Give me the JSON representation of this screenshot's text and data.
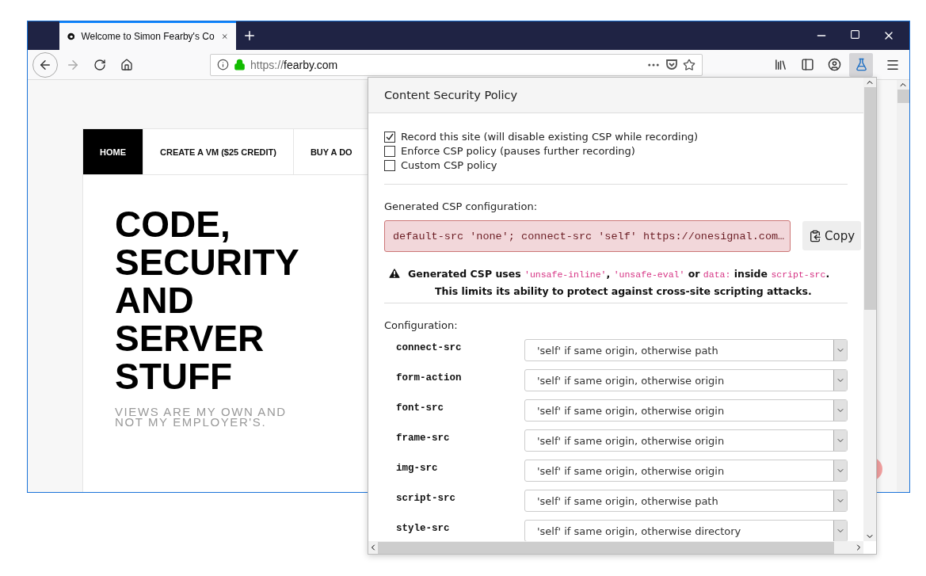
{
  "tab": {
    "title": "Welcome to Simon Fearby's Co"
  },
  "address_bar": {
    "scheme": "https://",
    "host": "fearby.com"
  },
  "toolbar": {
    "extension_active": true
  },
  "site_nav": [
    {
      "label": "HOME",
      "selected": true
    },
    {
      "label": "CREATE A VM ($25 CREDIT)",
      "selected": false
    },
    {
      "label": "BUY A DO",
      "selected": false
    }
  ],
  "site_title": "CODE, SECURITY AND SERVER STUFF",
  "site_tagline": "VIEWS ARE MY OWN AND NOT MY EMPLOYER'S.",
  "popup": {
    "title": "Content Security Policy",
    "options": [
      {
        "label": "Record this site (will disable existing CSP while recording)",
        "checked": true
      },
      {
        "label": "Enforce CSP policy (pauses further recording)",
        "checked": false
      },
      {
        "label": "Custom CSP policy",
        "checked": false
      }
    ],
    "generated_label": "Generated CSP configuration:",
    "generated_value": "default-src 'none'; connect-src 'self' https://onesignal.com…",
    "copy_button": "Copy",
    "warning": [
      {
        "kind": "text",
        "text": "Generated CSP uses "
      },
      {
        "kind": "code",
        "text": "'unsafe-inline'"
      },
      {
        "kind": "text",
        "text": ", "
      },
      {
        "kind": "code",
        "text": "'unsafe-eval'"
      },
      {
        "kind": "text",
        "text": " or "
      },
      {
        "kind": "code",
        "text": "data:"
      },
      {
        "kind": "text",
        "text": " inside "
      },
      {
        "kind": "code",
        "text": "script-src"
      },
      {
        "kind": "text",
        "text": "."
      }
    ],
    "warning_line_2": "This limits its ability to protect against cross-site scripting attacks.",
    "configuration_label": "Configuration:",
    "directives": [
      {
        "name": "connect-src",
        "value": "'self' if same origin, otherwise path"
      },
      {
        "name": "form-action",
        "value": "'self' if same origin, otherwise origin"
      },
      {
        "name": "font-src",
        "value": "'self' if same origin, otherwise origin"
      },
      {
        "name": "frame-src",
        "value": "'self' if same origin, otherwise origin"
      },
      {
        "name": "img-src",
        "value": "'self' if same origin, otherwise origin"
      },
      {
        "name": "script-src",
        "value": "'self' if same origin, otherwise path"
      },
      {
        "name": "style-src",
        "value": "'self' if same origin, otherwise directory"
      }
    ]
  }
}
